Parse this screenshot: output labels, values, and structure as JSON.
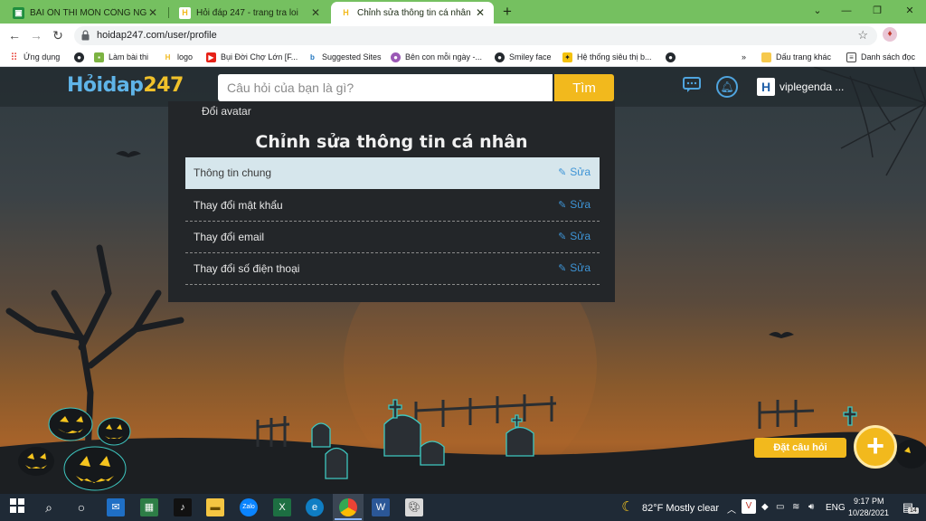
{
  "tabs": [
    {
      "title": "BÀI ÔN THI MÔN CÔNG NGHỆ (",
      "icon": "classroom-icon",
      "color": "#1e8e3e"
    },
    {
      "title": "Hỏi đáp 247 - trang tra loi",
      "icon": "hoidap-icon",
      "color": "#f2b91d"
    },
    {
      "title": "Chỉnh sửa thông tin cá nhân",
      "icon": "hoidap-icon",
      "color": "#f2b91d"
    }
  ],
  "address": {
    "url": "hoidap247.com/user/profile"
  },
  "bookmarks": [
    {
      "label": "Ứng dụng",
      "icon": "apps-grid-icon"
    },
    {
      "label": "",
      "icon": "github-icon"
    },
    {
      "label": "Làm bài thi",
      "icon": "page-icon"
    },
    {
      "label": "logo",
      "icon": "hoidap-icon"
    },
    {
      "label": "Bụi Đời Chợ Lớn [F...",
      "icon": "youtube-icon"
    },
    {
      "label": "Suggested Sites",
      "icon": "bing-icon"
    },
    {
      "label": "Bên con mỗi ngày -...",
      "icon": "site-icon"
    },
    {
      "label": "Smiley face",
      "icon": "github-icon"
    },
    {
      "label": "Hệ thống siêu thị b...",
      "icon": "runner-icon"
    },
    {
      "label": "",
      "icon": "github-icon"
    }
  ],
  "bookmarks_right": {
    "more": "»",
    "other": "Dấu trang khác",
    "reading_list": "Danh sách đọc"
  },
  "site": {
    "logo_text": "Hỏidap",
    "logo_num": "247",
    "search_placeholder": "Câu hỏi của bạn là gì?",
    "search_button": "Tìm",
    "username": "viplegenda ..."
  },
  "profile": {
    "change_avatar": "Đổi avatar",
    "title": "Chỉnh sửa thông tin cá nhân",
    "edit_label": "Sửa",
    "rows": [
      {
        "label": "Thông tin chung"
      },
      {
        "label": "Thay đổi mật khẩu"
      },
      {
        "label": "Thay đổi email"
      },
      {
        "label": "Thay đổi số điện thoại"
      }
    ]
  },
  "ask": {
    "label": "Đặt câu hỏi",
    "plus": "+"
  },
  "taskbar": {
    "weather": "82°F  Mostly clear",
    "lang": "ENG",
    "time": "9:17 PM",
    "date": "10/28/2021",
    "notifications": "14"
  }
}
